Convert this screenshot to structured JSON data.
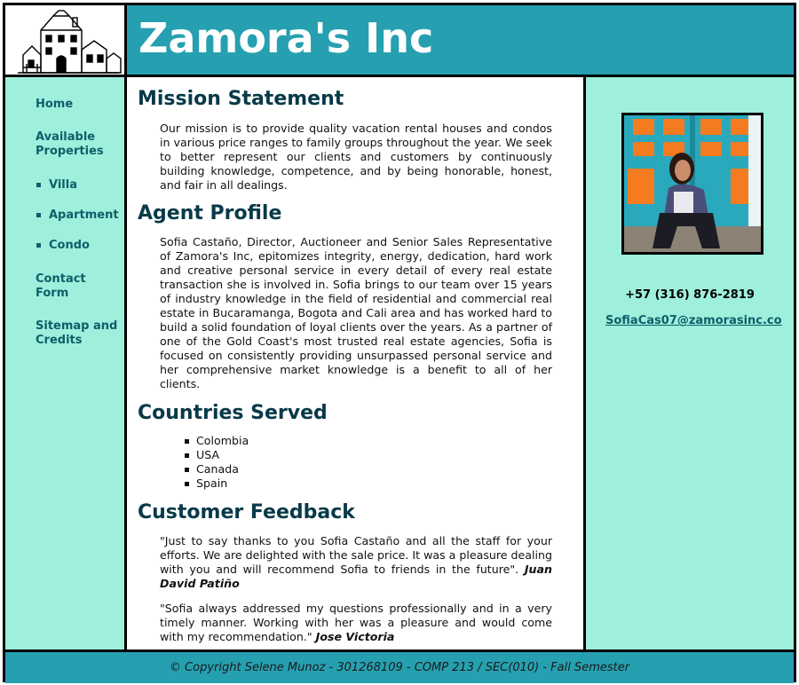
{
  "site": {
    "title": "Zamora's Inc"
  },
  "nav": {
    "home": "Home",
    "available_properties": "Available Properties",
    "sub_items": [
      "Villa",
      "Apartment",
      "Condo"
    ],
    "contact_form": "Contact Form",
    "sitemap": "Sitemap and Credits"
  },
  "main": {
    "mission_heading": "Mission Statement",
    "mission_text": "Our mission is to provide quality vacation rental houses and condos in various price ranges to family groups throughout the year. We seek to better represent our clients and customers by continuously building knowledge, competence, and by being honorable, honest, and fair in all dealings.",
    "agent_heading": "Agent Profile",
    "agent_text": "Sofia Castaño, Director, Auctioneer and Senior Sales Representative of Zamora's Inc, epitomizes integrity, energy, dedication, hard work and creative personal service in every detail of every real estate transaction she is involved in. Sofia brings to our team over 15 years of industry knowledge in the field of residential and commercial real estate in Bucaramanga, Bogota and Cali area and has worked hard to build a solid foundation of loyal clients over the years. As a partner of one of the Gold Coast's most trusted real estate agencies, Sofia is focused on consistently providing unsurpassed personal service and her comprehensive market knowledge is a benefit to all of her clients.",
    "countries_heading": "Countries Served",
    "countries": [
      "Colombia",
      "USA",
      "Canada",
      "Spain"
    ],
    "feedback_heading": "Customer Feedback",
    "feedback": [
      {
        "quote": "\"Just to say thanks to you Sofia Castaño and all the staff for your efforts. We are delighted with the sale price. It was a pleasure dealing with you and will recommend Sofia to friends in the future\".",
        "author": "Juan David Patiño"
      },
      {
        "quote": "\"Sofia always addressed my questions professionally and in a very timely manner. Working with her was a pleasure and would come with my recommendation.\"",
        "author": "Jose Victoria"
      }
    ]
  },
  "aside": {
    "phone": "+57 (316) 876-2819",
    "email": "SofiaCas07@zamorasinc.co"
  },
  "footer": {
    "copyright": "© Copyright Selene Munoz - 301268109 - COMP 213 / SEC(010) - Fall Semester"
  },
  "colors": {
    "header_bg": "#26a0b0",
    "side_bg": "#9ef0dc",
    "nav_link": "#0f5e6a",
    "heading": "#083a48"
  }
}
